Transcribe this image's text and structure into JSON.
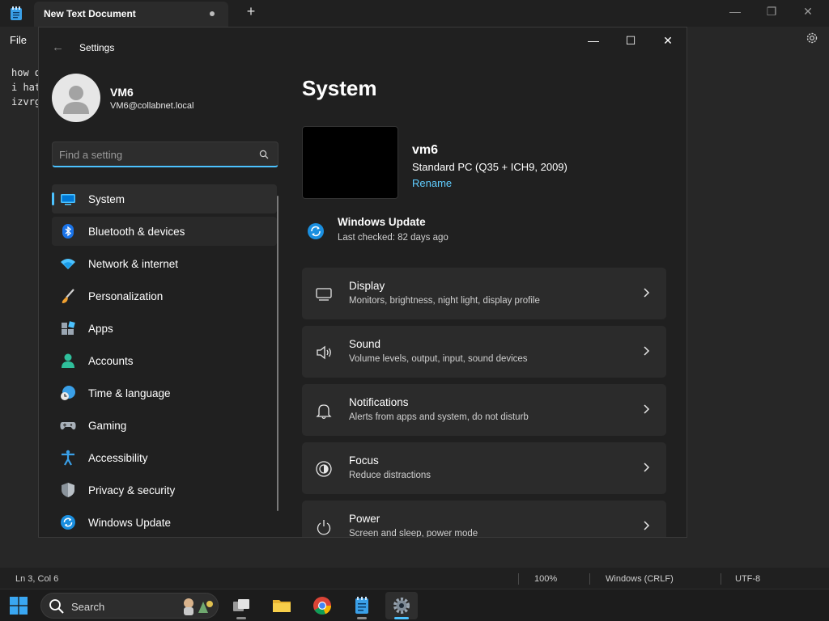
{
  "notepad": {
    "tab_title": "New Text Document",
    "new_tab_label": "+",
    "menu_file": "File",
    "lines": [
      "how d",
      "i hat",
      "izvrg"
    ],
    "status": {
      "position": "Ln 3, Col 6",
      "zoom": "100%",
      "line_ending": "Windows (CRLF)",
      "encoding": "UTF-8"
    }
  },
  "taskbar": {
    "search_label": "Search",
    "apps": [
      {
        "icon": "task-view-icon"
      },
      {
        "icon": "file-explorer-icon"
      },
      {
        "icon": "chrome-icon"
      },
      {
        "icon": "notepad-icon"
      },
      {
        "icon": "settings-icon",
        "active": true
      }
    ]
  },
  "settings": {
    "window_title": "Settings",
    "user": {
      "name": "VM6",
      "email": "VM6@collabnet.local"
    },
    "search_placeholder": "Find a setting",
    "nav": [
      {
        "label": "System",
        "icon": "monitor-icon",
        "selected": true
      },
      {
        "label": "Bluetooth & devices",
        "icon": "bluetooth-icon",
        "hovered": true
      },
      {
        "label": "Network & internet",
        "icon": "wifi-icon"
      },
      {
        "label": "Personalization",
        "icon": "brush-icon"
      },
      {
        "label": "Apps",
        "icon": "apps-icon"
      },
      {
        "label": "Accounts",
        "icon": "person-icon"
      },
      {
        "label": "Time & language",
        "icon": "globe-clock-icon"
      },
      {
        "label": "Gaming",
        "icon": "gamepad-icon"
      },
      {
        "label": "Accessibility",
        "icon": "accessibility-icon"
      },
      {
        "label": "Privacy & security",
        "icon": "shield-icon"
      },
      {
        "label": "Windows Update",
        "icon": "update-icon"
      }
    ],
    "page_title": "System",
    "device": {
      "name": "vm6",
      "model": "Standard PC (Q35 + ICH9, 2009)",
      "rename_label": "Rename"
    },
    "windows_update": {
      "title": "Windows Update",
      "subtitle": "Last checked: 82 days ago"
    },
    "cards": [
      {
        "title": "Display",
        "subtitle": "Monitors, brightness, night light, display profile",
        "icon": "display-icon"
      },
      {
        "title": "Sound",
        "subtitle": "Volume levels, output, input, sound devices",
        "icon": "speaker-icon"
      },
      {
        "title": "Notifications",
        "subtitle": "Alerts from apps and system, do not disturb",
        "icon": "bell-icon"
      },
      {
        "title": "Focus",
        "subtitle": "Reduce distractions",
        "icon": "focus-icon"
      },
      {
        "title": "Power",
        "subtitle": "Screen and sleep, power mode",
        "icon": "power-icon"
      }
    ],
    "colors": {
      "accent": "#4cc2ff",
      "link": "#60cdff",
      "window_bg": "#202020",
      "card_bg": "#2b2b2b"
    }
  }
}
